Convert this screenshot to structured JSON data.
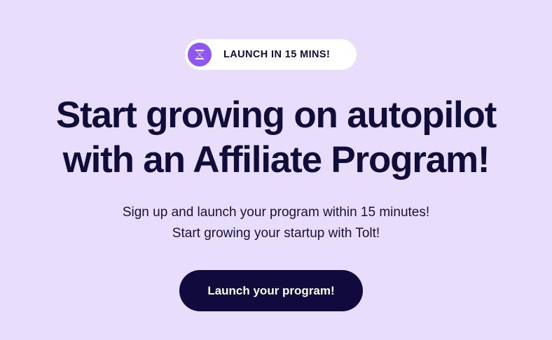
{
  "colors": {
    "background": "#e9ddfc",
    "badge_bg": "#ffffff",
    "badge_icon_bg": "#8f57f0",
    "text_primary": "#110d3b",
    "button_bg": "#110b3d",
    "button_text": "#ffffff"
  },
  "badge": {
    "icon": "tolt-logo-icon",
    "label": "LAUNCH IN 15 MINS!"
  },
  "headline": {
    "line1": "Start growing on autopilot",
    "line2": "with an Affiliate Program!"
  },
  "subtext": {
    "line1": "Sign up and launch your program within 15 minutes!",
    "line2": "Start growing your startup with Tolt!"
  },
  "cta": {
    "label": "Launch your program!"
  }
}
